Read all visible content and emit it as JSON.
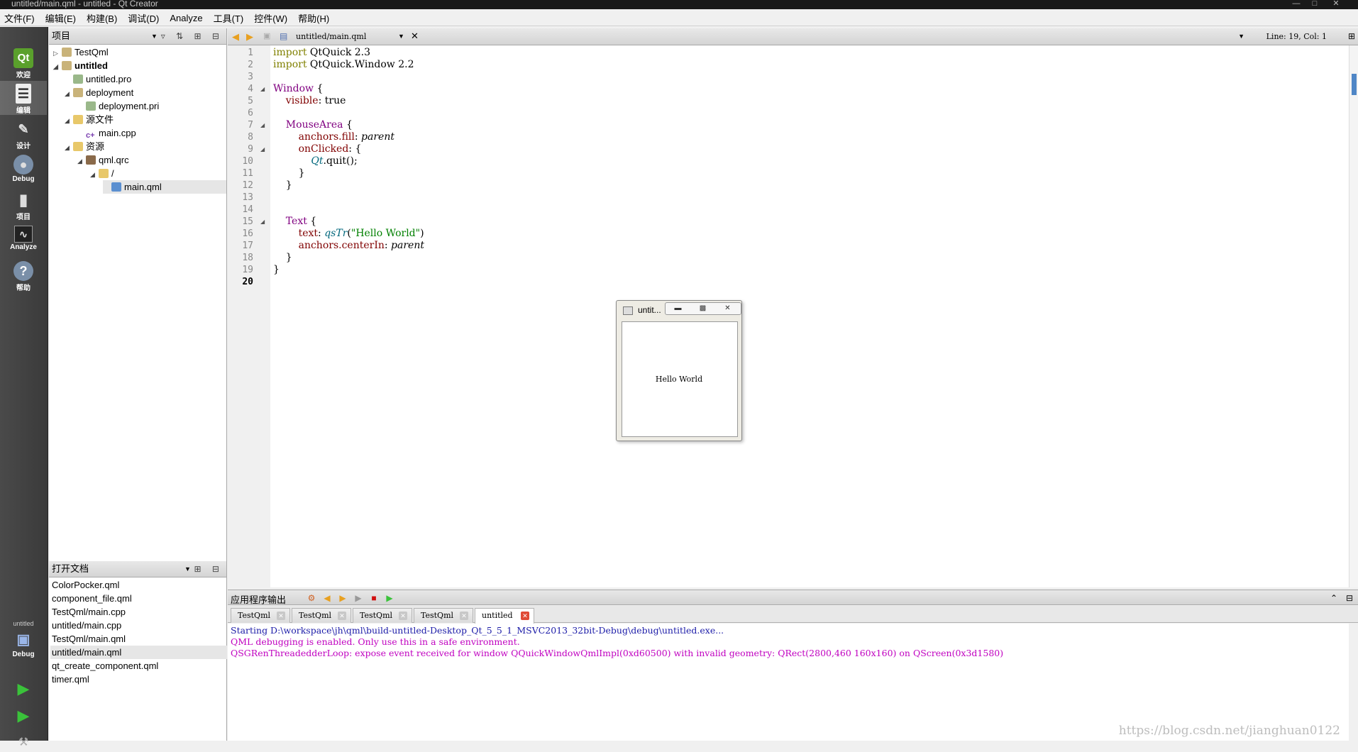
{
  "window": {
    "title": "untitled/main.qml - untitled - Qt Creator"
  },
  "menu": [
    "文件(F)",
    "编辑(E)",
    "构建(B)",
    "调试(D)",
    "Analyze",
    "工具(T)",
    "控件(W)",
    "帮助(H)"
  ],
  "modes": [
    {
      "label": "欢迎",
      "icon": "qt-logo-icon"
    },
    {
      "label": "编辑",
      "icon": "edit-document-icon"
    },
    {
      "label": "设计",
      "icon": "design-brush-icon"
    },
    {
      "label": "Debug",
      "icon": "debug-bug-icon"
    },
    {
      "label": "项目",
      "icon": "project-wrench-icon"
    },
    {
      "label": "Analyze",
      "icon": "analyze-graph-icon"
    },
    {
      "label": "帮助",
      "icon": "help-icon"
    }
  ],
  "kit": {
    "name": "untitled",
    "build": "Debug"
  },
  "project_pane": {
    "title": "项目",
    "tree": [
      {
        "label": "TestQml",
        "bold": false
      },
      {
        "label": "untitled",
        "bold": true
      },
      {
        "label": "untitled.pro",
        "bold": false
      },
      {
        "label": "deployment",
        "bold": false
      },
      {
        "label": "deployment.pri",
        "bold": false
      },
      {
        "label": "源文件",
        "bold": false
      },
      {
        "label": "main.cpp",
        "bold": false
      },
      {
        "label": "资源",
        "bold": false
      },
      {
        "label": "qml.qrc",
        "bold": false
      },
      {
        "label": "/",
        "bold": false
      },
      {
        "label": "main.qml",
        "bold": false
      }
    ]
  },
  "open_docs": {
    "title": "打开文档",
    "items": [
      "ColorPocker.qml",
      "component_file.qml",
      "TestQml/main.cpp",
      "untitled/main.cpp",
      "TestQml/main.qml",
      "untitled/main.qml",
      "qt_create_component.qml",
      "timer.qml"
    ],
    "selected_index": 5
  },
  "editor": {
    "file": "untitled/main.qml",
    "cursor": "Line: 19, Col: 1",
    "line_numbers": [
      "1",
      "2",
      "3",
      "4",
      "5",
      "6",
      "7",
      "8",
      "9",
      "10",
      "11",
      "12",
      "13",
      "14",
      "15",
      "16",
      "17",
      "18",
      "19",
      "20"
    ],
    "code": {
      "l1a": "import",
      "l1b": " QtQuick 2.3",
      "l2a": "import",
      "l2b": " QtQuick.Window 2.2",
      "l4a": "Window",
      "l4b": " {",
      "l5a": "    visible",
      "l5b": ": true",
      "l7a": "    MouseArea",
      "l7b": " {",
      "l8a": "        anchors.fill",
      "l8b": ": ",
      "l8c": "parent",
      "l9a": "        onClicked",
      "l9b": ": {",
      "l10a": "            Qt",
      "l10b": ".quit();",
      "l11": "        }",
      "l12": "    }",
      "l14a": "    Text",
      "l14b": " {",
      "l15a": "        text",
      "l15b": ": ",
      "l15c": "qsTr",
      "l15d": "(",
      "l15e": "\"Hello World\"",
      "l15f": ")",
      "l16a": "        anchors.centerIn",
      "l16b": ": ",
      "l16c": "parent",
      "l17": "    }",
      "l18": "}"
    }
  },
  "app_window": {
    "title": "untit...",
    "text": "Hello World"
  },
  "output": {
    "title": "应用程序输出",
    "tabs": [
      "TestQml",
      "TestQml",
      "TestQml",
      "TestQml",
      "untitled"
    ],
    "selected_tab": 4,
    "lines": [
      "Starting D:\\workspace\\jh\\qml\\build-untitled-Desktop_Qt_5_5_1_MSVC2013_32bit-Debug\\debug\\untitled.exe...",
      "QML debugging is enabled. Only use this in a safe environment.",
      "QSGRenThreadedderLoop: expose event received for window QQuickWindowQmlImpl(0xd60500) with invalid geometry: QRect(2800,460 160x160) on QScreen(0x3d1580)"
    ],
    "watermark": "https://blog.csdn.net/jianghuan0122"
  },
  "colors": {
    "accent": "#4f86c6",
    "keyword": "#808000",
    "type": "#800080",
    "property": "#800000",
    "string": "#008000",
    "error": "#c000c0",
    "stdout": "#1c1ca8"
  }
}
